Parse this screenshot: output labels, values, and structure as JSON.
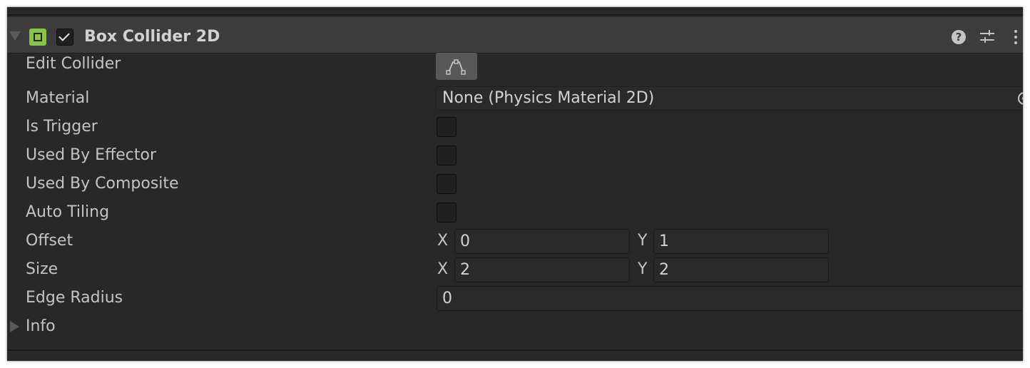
{
  "component": {
    "title": "Box Collider 2D",
    "enabled": true,
    "accent_color": "#8bc34a",
    "icons": [
      "box-collider-2d-icon",
      "help-icon",
      "presets-icon",
      "context-menu-icon",
      "edit-collider-icon",
      "object-picker-icon"
    ]
  },
  "fields": {
    "edit_collider": {
      "label": "Edit Collider"
    },
    "material": {
      "label": "Material",
      "value": "None (Physics Material 2D)"
    },
    "is_trigger": {
      "label": "Is Trigger",
      "checked": false
    },
    "used_by_effector": {
      "label": "Used By Effector",
      "checked": false
    },
    "used_by_composite": {
      "label": "Used By Composite",
      "checked": false
    },
    "auto_tiling": {
      "label": "Auto Tiling",
      "checked": false
    },
    "offset": {
      "label": "Offset",
      "x_label": "X",
      "x": "0",
      "y_label": "Y",
      "y": "1"
    },
    "size": {
      "label": "Size",
      "x_label": "X",
      "x": "2",
      "y_label": "Y",
      "y": "2"
    },
    "edge_radius": {
      "label": "Edge Radius",
      "value": "0"
    },
    "info": {
      "label": "Info"
    }
  }
}
